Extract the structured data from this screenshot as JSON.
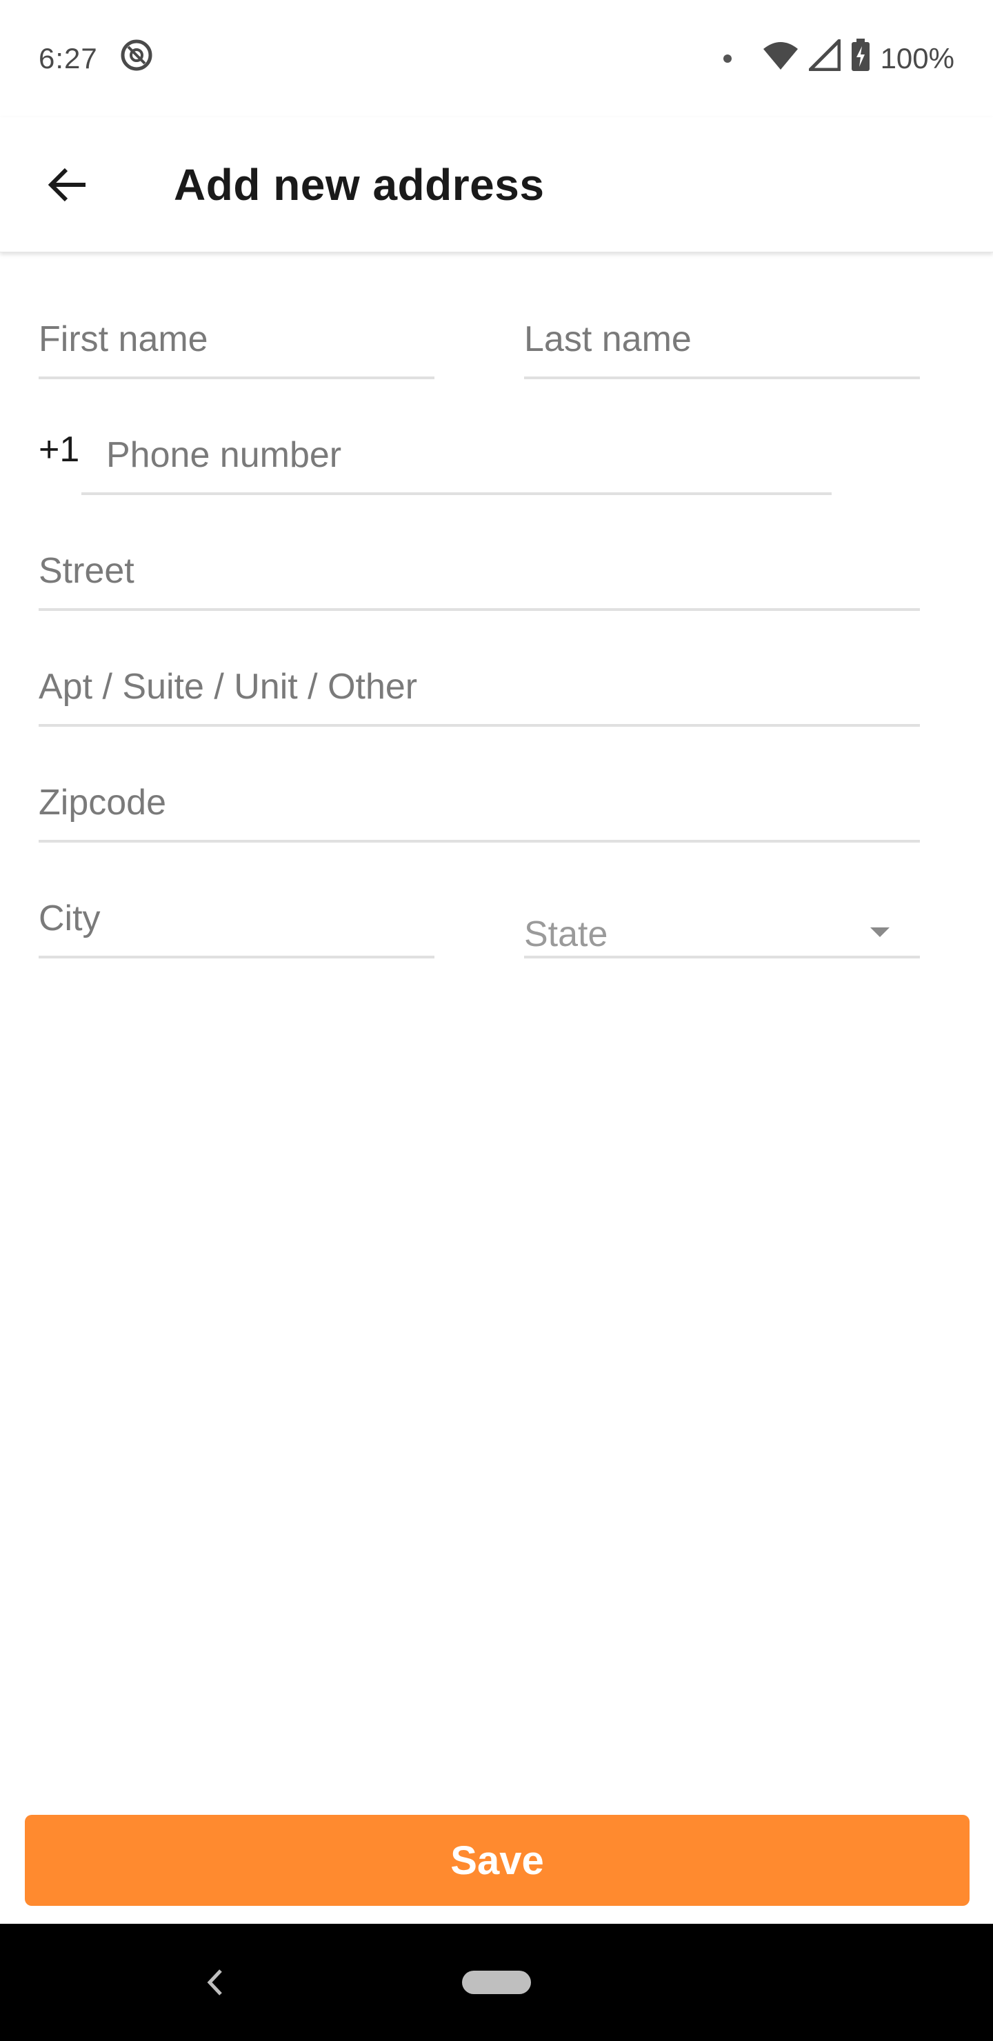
{
  "status_bar": {
    "time": "6:27",
    "battery": "100%"
  },
  "header": {
    "title": "Add new address"
  },
  "form": {
    "first_name_placeholder": "First name",
    "last_name_placeholder": "Last name",
    "phone_prefix": "+1",
    "phone_placeholder": "Phone number",
    "street_placeholder": "Street",
    "apt_placeholder": "Apt / Suite / Unit / Other",
    "zipcode_placeholder": "Zipcode",
    "city_placeholder": "City",
    "state_label": "State"
  },
  "actions": {
    "save_label": "Save"
  },
  "colors": {
    "accent": "#ff8a2f",
    "divider": "#e0e0e0",
    "placeholder": "#7a7a7a"
  }
}
